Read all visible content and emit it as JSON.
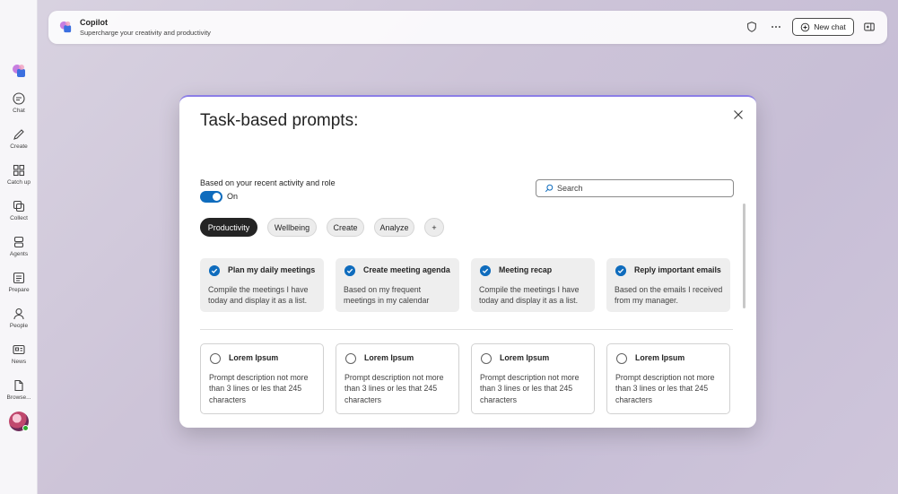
{
  "app": {
    "title": "Copilot",
    "subtitle": "Supercharge your creativity and productivity",
    "new_chat_label": "New chat"
  },
  "rail": {
    "items": [
      {
        "label": "Chat",
        "icon": "chat-icon"
      },
      {
        "label": "Create",
        "icon": "pen-icon"
      },
      {
        "label": "Catch up",
        "icon": "grid-icon"
      },
      {
        "label": "Collect",
        "icon": "collect-icon"
      },
      {
        "label": "Agents",
        "icon": "agents-icon"
      },
      {
        "label": "Prepare",
        "icon": "document-list-icon"
      },
      {
        "label": "People",
        "icon": "person-icon"
      },
      {
        "label": "News",
        "icon": "news-icon"
      },
      {
        "label": "Browse...",
        "icon": "file-icon"
      }
    ]
  },
  "modal": {
    "title": "Task-based prompts:",
    "based_on_label": "Based on your recent activity and role",
    "toggle_label": "On",
    "search_placeholder": "Search",
    "chips": [
      "Productivity",
      "Wellbeing",
      "Create",
      "Analyze",
      "+"
    ],
    "active_chip": "Productivity",
    "suggested": [
      {
        "title": "Plan my daily meetings",
        "desc": "Compile the meetings I have today and display it as a list."
      },
      {
        "title": "Create meeting agenda",
        "desc": "Based on my frequent meetings in my calendar"
      },
      {
        "title": "Meeting recap",
        "desc": "Compile the meetings I have today and display it as a list."
      },
      {
        "title": "Reply important emails",
        "desc": "Based on the emails I received from my manager."
      }
    ],
    "more": [
      {
        "title": "Lorem Ipsum",
        "desc": "Prompt description not more than 3 lines or les that 245 characters"
      },
      {
        "title": "Lorem Ipsum",
        "desc": "Prompt description not more than 3 lines or les that 245 characters"
      },
      {
        "title": "Lorem Ipsum",
        "desc": "Prompt description not more than 3 lines or les that 245 characters"
      },
      {
        "title": "Lorem Ipsum",
        "desc": "Prompt description not more than 3 lines or les that 245 characters"
      }
    ]
  },
  "colors": {
    "accent": "#0f6cbd",
    "active_chip": "#242424",
    "selected_card": "#eeeeee"
  }
}
